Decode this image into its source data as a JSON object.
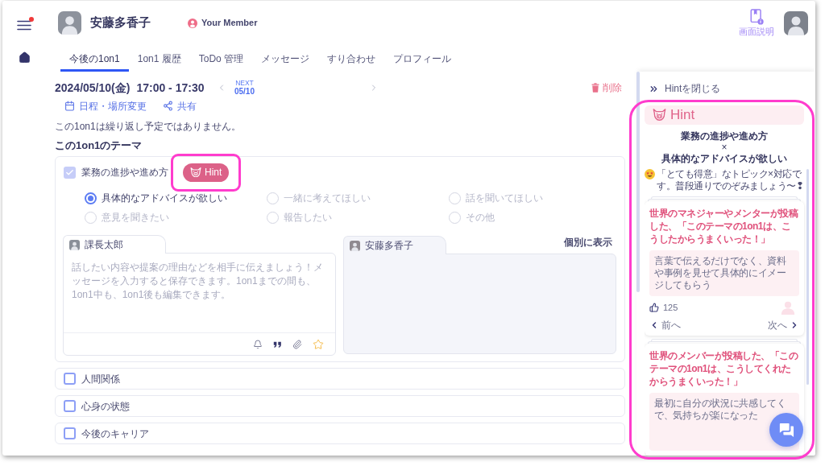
{
  "nav": {
    "menu_notification": true
  },
  "header": {
    "user_name": "安藤多香子",
    "role": "Your Member",
    "help_label": "画面説明"
  },
  "tabs": [
    {
      "label": "今後の1on1",
      "selected": true
    },
    {
      "label": "1on1 履歴",
      "selected": false
    },
    {
      "label": "ToDo 管理",
      "selected": false
    },
    {
      "label": "メッセージ",
      "selected": false
    },
    {
      "label": "すり合わせ",
      "selected": false
    },
    {
      "label": "プロフィール",
      "selected": false
    }
  ],
  "meeting": {
    "date": "2024/05/10(金)",
    "time": "17:00 - 17:30",
    "pager": {
      "caption": "NEXT",
      "date": "05/10"
    },
    "delete_label": "削除",
    "actions": [
      {
        "kind": "reschedule",
        "label": "日程・場所変更"
      },
      {
        "kind": "share",
        "label": "共有"
      }
    ],
    "recurrence_note": "この1on1は繰り返し予定ではありません。"
  },
  "themes": {
    "heading": "この1on1のテーマ",
    "items": [
      {
        "label": "業務の進捗や進め方",
        "checked": true,
        "expanded": true,
        "hint_label": "Hint",
        "options": [
          {
            "label": "具体的なアドバイスが欲しい",
            "selected": true
          },
          {
            "label": "一緒に考えてほしい",
            "selected": false
          },
          {
            "label": "話を聞いてほしい",
            "selected": false
          },
          {
            "label": "意見を聞きたい",
            "selected": false
          },
          {
            "label": "報告したい",
            "selected": false
          },
          {
            "label": "その他",
            "selected": false
          }
        ],
        "comments": [
          {
            "kind": "editor",
            "author": "課長太郎",
            "placeholder": "話したい内容や提案の理由などを相手に伝えましょう！メッセージを入力すると保存できます。1on1までの間も、1on1中も、1on1後も編集できます。"
          },
          {
            "kind": "readonly",
            "author": "安藤多香子",
            "toggle_label": "個別に表示"
          }
        ]
      },
      {
        "label": "人間関係",
        "checked": false,
        "expanded": false
      },
      {
        "label": "心身の状態",
        "checked": false,
        "expanded": false
      },
      {
        "label": "今後のキャリア",
        "checked": false,
        "expanded": false
      }
    ]
  },
  "hint_panel": {
    "close_label": "Hintを閉じる",
    "title": "Hint",
    "topic": "業務の進捗や進め方",
    "joiner": "×",
    "request": "具体的なアドバイスが欲しい",
    "message": "「とても得意」なトピック×対応です。普段通りでのぞみましょう〜❢",
    "cards": [
      {
        "title": "世界のマネジャーやメンターが投稿した、「このテーマの1on1は、こうしたからうまくいった！」",
        "body_lines": [
          "言葉で伝えるだけでなく、資料や事例を見せて具体的にイメージしてもらう"
        ],
        "likes": "125",
        "prev_label": "前へ",
        "next_label": "次へ"
      },
      {
        "title": "世界のメンバーが投稿した、「このテーマの1on1は、こうしてくれたからうまくいった！」",
        "body_lines": [
          "最初に自分の状況に共感してく",
          "で、気持ちが楽になった"
        ]
      }
    ]
  },
  "highlights": {
    "hint_button": true,
    "hint_panel": true
  }
}
